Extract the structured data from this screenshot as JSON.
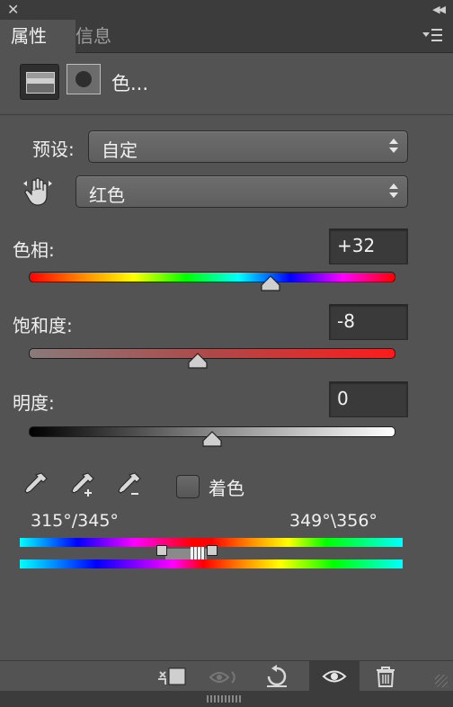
{
  "window": {
    "close_icon": "close-icon",
    "collapse_icon": "double-chevron-left-icon"
  },
  "tabs": [
    {
      "label": "属性",
      "active": true
    },
    {
      "label": "信息",
      "active": false
    }
  ],
  "header": {
    "title": "色..."
  },
  "preset": {
    "label": "预设:",
    "value": "自定"
  },
  "channel": {
    "value": "红色"
  },
  "hue": {
    "label": "色相:",
    "value": "+32",
    "slider_fraction": 0.66
  },
  "saturation": {
    "label": "饱和度:",
    "value": "-8",
    "slider_fraction": 0.46
  },
  "lightness": {
    "label": "明度:",
    "value": "0",
    "slider_fraction": 0.5
  },
  "colorize": {
    "label": "着色",
    "checked": false
  },
  "range": {
    "left": "315°/345°",
    "right": "349°\\356°"
  },
  "colors": {
    "panel_bg": "#535353",
    "dark_bg": "#3c3c3c"
  }
}
